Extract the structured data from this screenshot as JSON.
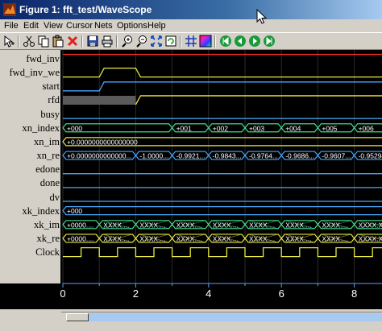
{
  "window": {
    "title": "Figure 1: fft_test/WaveScope"
  },
  "menu": [
    "File",
    "Edit",
    "View",
    "Cursor",
    "Nets",
    "Options",
    "Help"
  ],
  "toolbar": [
    "cursor-tool-icon",
    "cut-icon",
    "copy-icon",
    "paste-icon",
    "delete-icon",
    "save-icon",
    "print-icon",
    "zoom-in-icon",
    "zoom-out-icon",
    "zoom-fit-icon",
    "refresh-icon",
    "grid-icon",
    "color-icon",
    "first-icon",
    "previous-icon",
    "next-icon",
    "last-icon"
  ],
  "signals": [
    {
      "name": "fwd_inv",
      "color": "#ff2b2b",
      "kind": "level",
      "level": 1
    },
    {
      "name": "fwd_inv_we",
      "color": "#e8e840",
      "kind": "pulse",
      "rise": 1,
      "fall": 2
    },
    {
      "name": "start",
      "color": "#49a7ff",
      "kind": "step",
      "rise": 1
    },
    {
      "name": "rfd",
      "color": "#e8e840",
      "kind": "undefined_then_high",
      "rise": 2
    },
    {
      "name": "busy",
      "color": "#49a7ff",
      "kind": "level",
      "level": 0
    },
    {
      "name": "xn_index",
      "color": "#3fe08f",
      "kind": "bus",
      "values": [
        "+000",
        "+001",
        "+002",
        "+003",
        "+004",
        "+005",
        "+006"
      ],
      "edges": [
        0,
        3,
        4,
        5,
        6,
        7,
        8
      ]
    },
    {
      "name": "xn_im",
      "color": "#e8e840",
      "kind": "bus",
      "values": [
        "+0.0000000000000000"
      ],
      "edges": [
        0
      ]
    },
    {
      "name": "xn_re",
      "color": "#49a7ff",
      "kind": "bus",
      "values": [
        "+0.0000000000000000",
        "-1.0000000000000000",
        "-0.99215674781799316",
        "-0.98431372642517090",
        "-0.97647058963775635",
        "-0.96862745285034180",
        "-0.96078431606292725",
        "-0.95294117927551270"
      ],
      "edges": [
        0,
        2,
        3,
        4,
        5,
        6,
        7,
        8
      ]
    },
    {
      "name": "edone",
      "color": "#49a7ff",
      "kind": "level",
      "level": 0
    },
    {
      "name": "done",
      "color": "#49a7ff",
      "kind": "level",
      "level": 0
    },
    {
      "name": "dv",
      "color": "#49a7ff",
      "kind": "level",
      "level": 0
    },
    {
      "name": "xk_index",
      "color": "#49a7ff",
      "kind": "bus",
      "values": [
        "+000"
      ],
      "edges": [
        0
      ]
    },
    {
      "name": "xk_im",
      "color": "#3fe08f",
      "kind": "bus_x",
      "values": [
        "+0000.0000000000",
        "XXXX.XXXXXXXXXX",
        "XXXX.XXXXXXXXXX",
        "XXXX.XXXXXXXXXX",
        "XXXX.XXXXXXXXXX",
        "XXXX.XXXXXXXXXX",
        "XXXX.XXXXXXXXXX",
        "XXXX.XXXXXXXXXX",
        "XXXX.XXXXXXXXXX"
      ],
      "edges": [
        0,
        1,
        2,
        3,
        4,
        5,
        6,
        7,
        8
      ]
    },
    {
      "name": "xk_re",
      "color": "#e8e840",
      "kind": "bus_x",
      "values": [
        "+0000.0000000000",
        "XXXX.XXXXXXXXXX",
        "XXXX.XXXXXXXXXX",
        "XXXX.XXXXXXXXXX",
        "XXXX.XXXXXXXXXX",
        "XXXX.XXXXXXXXXX",
        "XXXX.XXXXXXXXXX",
        "XXXX.XXXXXXXXXX",
        "XXXX.XXXXXXXXXX"
      ],
      "edges": [
        0,
        1,
        2,
        3,
        4,
        5,
        6,
        7,
        8
      ]
    },
    {
      "name": "Clock",
      "color": "#e8e840",
      "kind": "clock",
      "period": 1,
      "first_rise": 0.5
    }
  ],
  "time_axis": {
    "ticks": [
      "0",
      "2",
      "4",
      "6",
      "8"
    ],
    "tick_values": [
      0,
      2,
      4,
      6,
      8
    ],
    "range": [
      0,
      8.7
    ]
  },
  "colors": {
    "grid": "#2a2a2a",
    "axis": "#5aa0ff",
    "undefined": "#5a5a5a",
    "xfill": "#3fe08f"
  }
}
